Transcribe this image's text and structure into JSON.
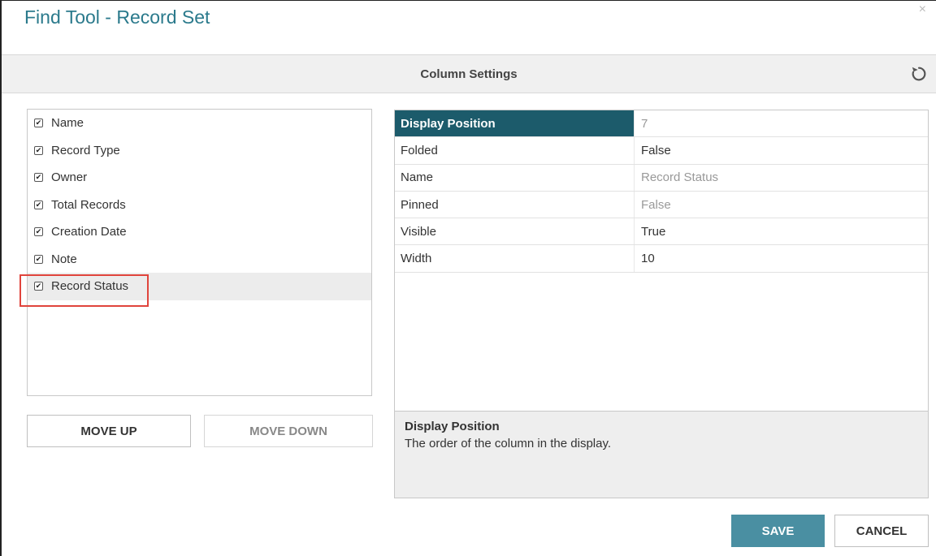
{
  "dialog": {
    "title": "Find Tool - Record Set",
    "close_glyph": "×"
  },
  "toolbar": {
    "title": "Column Settings",
    "reset_icon": "refresh-icon"
  },
  "columns": [
    {
      "label": "Name",
      "checked": true
    },
    {
      "label": "Record Type",
      "checked": true
    },
    {
      "label": "Owner",
      "checked": true
    },
    {
      "label": "Total Records",
      "checked": true
    },
    {
      "label": "Creation Date",
      "checked": true
    },
    {
      "label": "Note",
      "checked": true
    },
    {
      "label": "Record Status",
      "checked": true,
      "selected": true
    }
  ],
  "buttons": {
    "move_up": "MOVE UP",
    "move_down": "MOVE DOWN",
    "save": "SAVE",
    "cancel": "CANCEL"
  },
  "properties": [
    {
      "key": "Display Position",
      "value": "7",
      "readonly": true,
      "active": true
    },
    {
      "key": "Folded",
      "value": "False",
      "readonly": false
    },
    {
      "key": "Name",
      "value": "Record Status",
      "readonly": true
    },
    {
      "key": "Pinned",
      "value": "False",
      "readonly": true
    },
    {
      "key": "Visible",
      "value": "True",
      "readonly": false
    },
    {
      "key": "Width",
      "value": "10",
      "readonly": false
    }
  ],
  "description": {
    "title": "Display Position",
    "text": "The order of the column in the display."
  },
  "colors": {
    "accent": "#2b7a8c",
    "header_active": "#1c5b6b",
    "save": "#4a8fa2",
    "highlight": "#e0443c"
  }
}
